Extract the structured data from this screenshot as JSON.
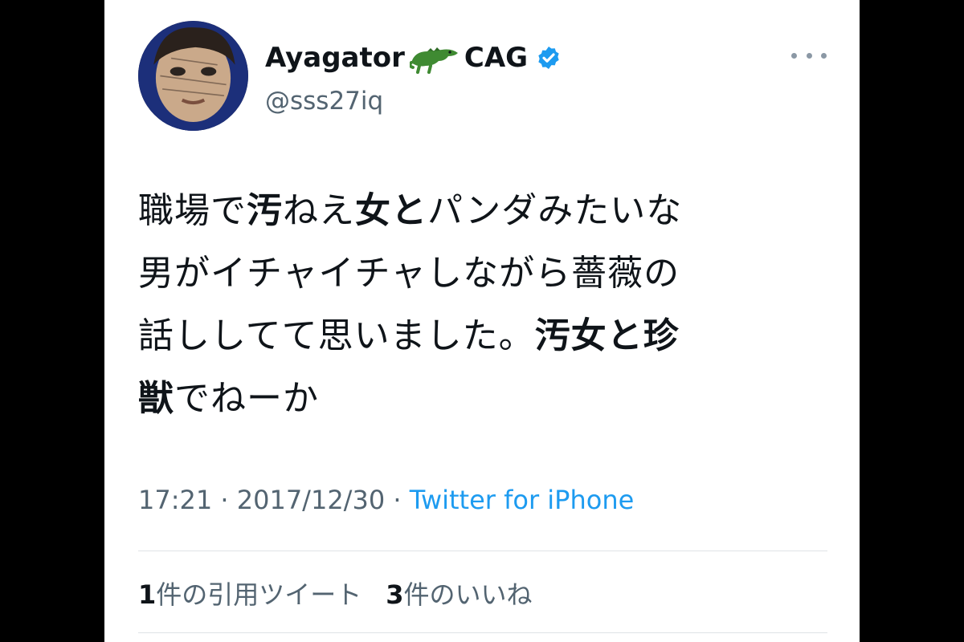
{
  "author": {
    "display_name": "Ayagator",
    "name_suffix": "CAG",
    "name_emoji": "crocodile-emoji",
    "handle": "@sss27iq",
    "verified": true
  },
  "tweet": {
    "segments": [
      [
        {
          "t": "職場で",
          "b": false
        },
        {
          "t": "汚",
          "b": true
        },
        {
          "t": "ねえ",
          "b": false
        },
        {
          "t": "女と",
          "b": true
        },
        {
          "t": "パンダみたいな",
          "b": false
        }
      ],
      [
        {
          "t": "男がイチャイチャしながら薔薇の",
          "b": false
        }
      ],
      [
        {
          "t": "話ししてて思いました。",
          "b": false
        },
        {
          "t": "汚女と珍",
          "b": true
        }
      ],
      [
        {
          "t": "獣",
          "b": true
        },
        {
          "t": "でねーか",
          "b": false
        }
      ]
    ]
  },
  "meta": {
    "time": "17:21",
    "separator": " · ",
    "date": "2017/12/30",
    "source": "Twitter for iPhone"
  },
  "stats": {
    "quotes_num": "1",
    "quotes_label": "件の引用ツイート",
    "likes_num": "3",
    "likes_label": "件のいいね"
  },
  "colors": {
    "text": "#0f1419",
    "secondary": "#536471",
    "link": "#1d9bf0",
    "verified": "#1d9bf0",
    "background": "#ffffff",
    "letterbox": "#000000"
  }
}
